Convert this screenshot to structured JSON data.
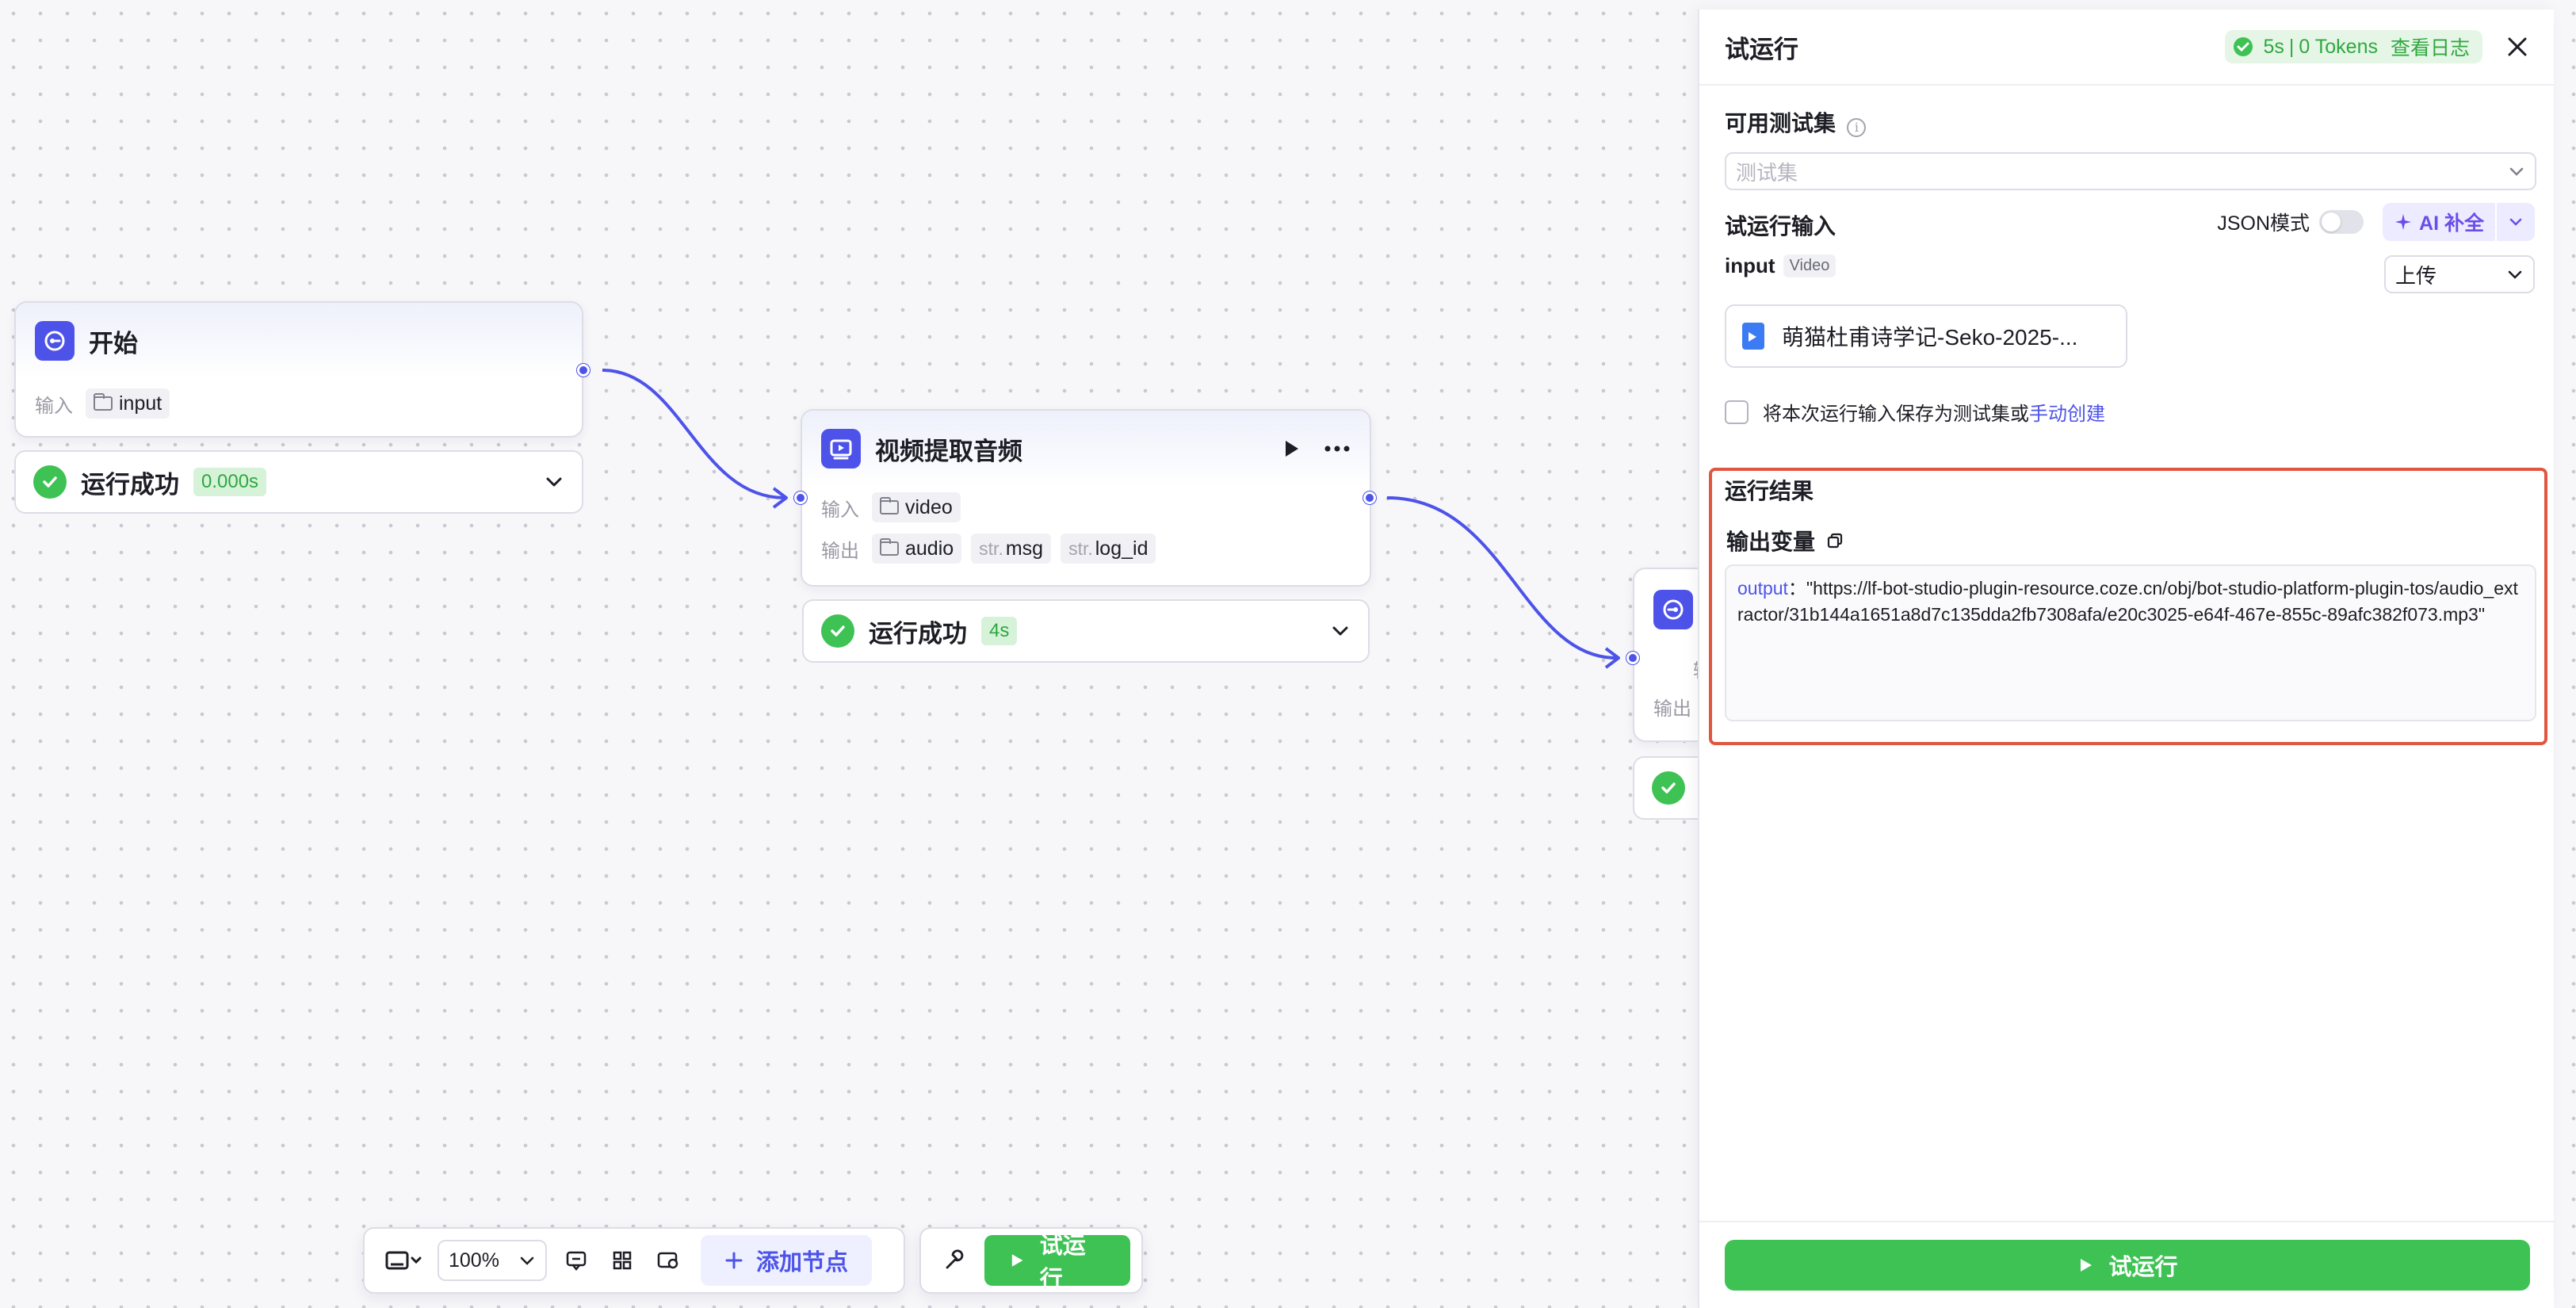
{
  "nodes": {
    "start": {
      "title": "开始",
      "input_label": "输入",
      "input_tag": "input",
      "status": "运行成功",
      "time": "0.000s"
    },
    "extract": {
      "title": "视频提取音频",
      "input_label": "输入",
      "input_tag": "video",
      "output_label": "输出",
      "outputs": [
        {
          "prefix": "",
          "name": "audio"
        },
        {
          "prefix": "str.",
          "name": "msg"
        },
        {
          "prefix": "str.",
          "name": "log_id"
        }
      ],
      "status": "运行成功",
      "time": "4s"
    },
    "end": {
      "row_label_1": "输",
      "row_label_2": "输出"
    }
  },
  "toolbar": {
    "zoom": "100%",
    "add_node": "添加节点",
    "run": "试运行"
  },
  "panel": {
    "title": "试运行",
    "stat_time": "5s",
    "stat_tokens": "0 Tokens",
    "view_log": "查看日志",
    "testset_title": "可用测试集",
    "testset_placeholder": "测试集",
    "input_title": "试运行输入",
    "json_mode": "JSON模式",
    "ai_fill": "AI 补全",
    "input_name": "input",
    "input_type": "Video",
    "upload": "上传",
    "file_name": "萌猫杜甫诗学记-Seko-2025-...",
    "save_text": "将本次运行输入保存为测试集或",
    "manual_create": "手动创建",
    "result_title": "运行结果",
    "output_vars_title": "输出变量",
    "output_key": "output",
    "output_value": "：\"https://lf-bot-studio-plugin-resource.coze.cn/obj/bot-studio-platform-plugin-tos/audio_extractor/31b144a1651a8d7c135dda2fb7308afa/e20c3025-e64f-467e-855c-89afc382f073.mp3\"",
    "run_button": "试运行"
  },
  "colors": {
    "accent": "#4d53e8",
    "success": "#3ec254",
    "highlight_border": "#e0563f"
  }
}
